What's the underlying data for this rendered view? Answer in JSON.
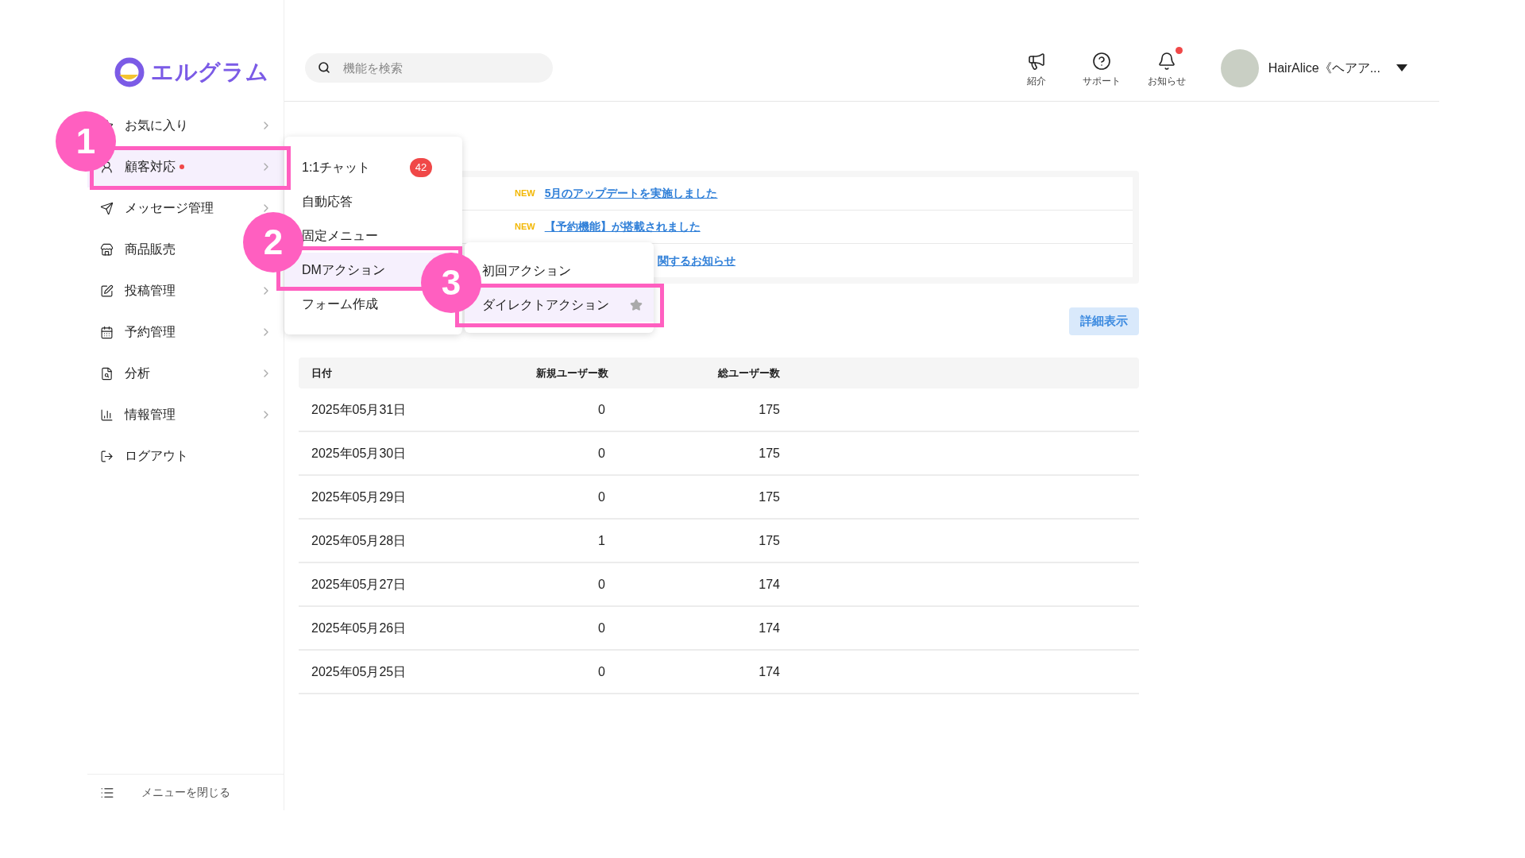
{
  "logo": {
    "text": "エルグラム"
  },
  "search": {
    "placeholder": "機能を検索"
  },
  "header_actions": [
    {
      "label": "紹介",
      "kind": "megaphone",
      "badge": false
    },
    {
      "label": "サポート",
      "kind": "help",
      "badge": false
    },
    {
      "label": "お知らせ",
      "kind": "bell",
      "badge": true
    }
  ],
  "account": {
    "name": "HairAlice《ヘアア..."
  },
  "sidebar": {
    "items": [
      {
        "label": "お気に入り",
        "selected": false,
        "dot": false
      },
      {
        "label": "顧客対応",
        "selected": true,
        "dot": true
      },
      {
        "label": "メッセージ管理",
        "selected": false,
        "dot": false
      },
      {
        "label": "商品販売",
        "selected": false,
        "dot": false
      },
      {
        "label": "投稿管理",
        "selected": false,
        "dot": false
      },
      {
        "label": "予約管理",
        "selected": false,
        "dot": false
      },
      {
        "label": "分析",
        "selected": false,
        "dot": false
      },
      {
        "label": "情報管理",
        "selected": false,
        "dot": false
      },
      {
        "label": "ログアウト",
        "selected": false,
        "dot": false
      }
    ],
    "footer": "メニューを閉じる"
  },
  "menu": {
    "items": [
      {
        "label": "1:1チャット",
        "badge": "42",
        "selected": false
      },
      {
        "label": "自動応答",
        "selected": false
      },
      {
        "label": "固定メニュー",
        "selected": false
      },
      {
        "label": "DMアクション",
        "selected": true
      },
      {
        "label": "フォーム作成",
        "selected": false
      }
    ]
  },
  "submenu": {
    "items": [
      {
        "label": "初回アクション",
        "selected": false
      },
      {
        "label": "ダイレクトアクション",
        "selected": true
      }
    ]
  },
  "news": [
    {
      "tag": "NEW",
      "title": "5月のアップデートを実施しました"
    },
    {
      "tag": "NEW",
      "title": "【予約機能】が搭載されました"
    },
    {
      "title": "関するお知らせ"
    }
  ],
  "detail_button": "詳細表示",
  "table": {
    "columns": [
      "日付",
      "新規ユーザー数",
      "総ユーザー数"
    ],
    "rows": [
      [
        "2025年05月31日",
        "0",
        "175"
      ],
      [
        "2025年05月30日",
        "0",
        "175"
      ],
      [
        "2025年05月29日",
        "0",
        "175"
      ],
      [
        "2025年05月28日",
        "1",
        "175"
      ],
      [
        "2025年05月27日",
        "0",
        "174"
      ],
      [
        "2025年05月26日",
        "0",
        "174"
      ],
      [
        "2025年05月25日",
        "0",
        "174"
      ]
    ]
  },
  "callouts": [
    {
      "number": "1"
    },
    {
      "number": "2"
    },
    {
      "number": "3"
    }
  ]
}
